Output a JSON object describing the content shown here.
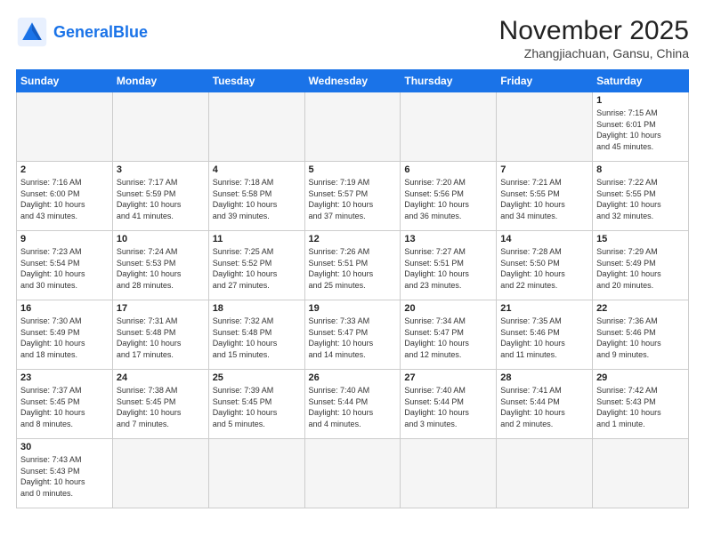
{
  "logo": {
    "text_general": "General",
    "text_blue": "Blue"
  },
  "title": "November 2025",
  "subtitle": "Zhangjiachuan, Gansu, China",
  "weekdays": [
    "Sunday",
    "Monday",
    "Tuesday",
    "Wednesday",
    "Thursday",
    "Friday",
    "Saturday"
  ],
  "weeks": [
    [
      {
        "day": "",
        "info": "",
        "empty": true
      },
      {
        "day": "",
        "info": "",
        "empty": true
      },
      {
        "day": "",
        "info": "",
        "empty": true
      },
      {
        "day": "",
        "info": "",
        "empty": true
      },
      {
        "day": "",
        "info": "",
        "empty": true
      },
      {
        "day": "",
        "info": "",
        "empty": true
      },
      {
        "day": "1",
        "info": "Sunrise: 7:15 AM\nSunset: 6:01 PM\nDaylight: 10 hours\nand 45 minutes."
      }
    ],
    [
      {
        "day": "2",
        "info": "Sunrise: 7:16 AM\nSunset: 6:00 PM\nDaylight: 10 hours\nand 43 minutes."
      },
      {
        "day": "3",
        "info": "Sunrise: 7:17 AM\nSunset: 5:59 PM\nDaylight: 10 hours\nand 41 minutes."
      },
      {
        "day": "4",
        "info": "Sunrise: 7:18 AM\nSunset: 5:58 PM\nDaylight: 10 hours\nand 39 minutes."
      },
      {
        "day": "5",
        "info": "Sunrise: 7:19 AM\nSunset: 5:57 PM\nDaylight: 10 hours\nand 37 minutes."
      },
      {
        "day": "6",
        "info": "Sunrise: 7:20 AM\nSunset: 5:56 PM\nDaylight: 10 hours\nand 36 minutes."
      },
      {
        "day": "7",
        "info": "Sunrise: 7:21 AM\nSunset: 5:55 PM\nDaylight: 10 hours\nand 34 minutes."
      },
      {
        "day": "8",
        "info": "Sunrise: 7:22 AM\nSunset: 5:55 PM\nDaylight: 10 hours\nand 32 minutes."
      }
    ],
    [
      {
        "day": "9",
        "info": "Sunrise: 7:23 AM\nSunset: 5:54 PM\nDaylight: 10 hours\nand 30 minutes."
      },
      {
        "day": "10",
        "info": "Sunrise: 7:24 AM\nSunset: 5:53 PM\nDaylight: 10 hours\nand 28 minutes."
      },
      {
        "day": "11",
        "info": "Sunrise: 7:25 AM\nSunset: 5:52 PM\nDaylight: 10 hours\nand 27 minutes."
      },
      {
        "day": "12",
        "info": "Sunrise: 7:26 AM\nSunset: 5:51 PM\nDaylight: 10 hours\nand 25 minutes."
      },
      {
        "day": "13",
        "info": "Sunrise: 7:27 AM\nSunset: 5:51 PM\nDaylight: 10 hours\nand 23 minutes."
      },
      {
        "day": "14",
        "info": "Sunrise: 7:28 AM\nSunset: 5:50 PM\nDaylight: 10 hours\nand 22 minutes."
      },
      {
        "day": "15",
        "info": "Sunrise: 7:29 AM\nSunset: 5:49 PM\nDaylight: 10 hours\nand 20 minutes."
      }
    ],
    [
      {
        "day": "16",
        "info": "Sunrise: 7:30 AM\nSunset: 5:49 PM\nDaylight: 10 hours\nand 18 minutes."
      },
      {
        "day": "17",
        "info": "Sunrise: 7:31 AM\nSunset: 5:48 PM\nDaylight: 10 hours\nand 17 minutes."
      },
      {
        "day": "18",
        "info": "Sunrise: 7:32 AM\nSunset: 5:48 PM\nDaylight: 10 hours\nand 15 minutes."
      },
      {
        "day": "19",
        "info": "Sunrise: 7:33 AM\nSunset: 5:47 PM\nDaylight: 10 hours\nand 14 minutes."
      },
      {
        "day": "20",
        "info": "Sunrise: 7:34 AM\nSunset: 5:47 PM\nDaylight: 10 hours\nand 12 minutes."
      },
      {
        "day": "21",
        "info": "Sunrise: 7:35 AM\nSunset: 5:46 PM\nDaylight: 10 hours\nand 11 minutes."
      },
      {
        "day": "22",
        "info": "Sunrise: 7:36 AM\nSunset: 5:46 PM\nDaylight: 10 hours\nand 9 minutes."
      }
    ],
    [
      {
        "day": "23",
        "info": "Sunrise: 7:37 AM\nSunset: 5:45 PM\nDaylight: 10 hours\nand 8 minutes."
      },
      {
        "day": "24",
        "info": "Sunrise: 7:38 AM\nSunset: 5:45 PM\nDaylight: 10 hours\nand 7 minutes."
      },
      {
        "day": "25",
        "info": "Sunrise: 7:39 AM\nSunset: 5:45 PM\nDaylight: 10 hours\nand 5 minutes."
      },
      {
        "day": "26",
        "info": "Sunrise: 7:40 AM\nSunset: 5:44 PM\nDaylight: 10 hours\nand 4 minutes."
      },
      {
        "day": "27",
        "info": "Sunrise: 7:40 AM\nSunset: 5:44 PM\nDaylight: 10 hours\nand 3 minutes."
      },
      {
        "day": "28",
        "info": "Sunrise: 7:41 AM\nSunset: 5:44 PM\nDaylight: 10 hours\nand 2 minutes."
      },
      {
        "day": "29",
        "info": "Sunrise: 7:42 AM\nSunset: 5:43 PM\nDaylight: 10 hours\nand 1 minute."
      }
    ],
    [
      {
        "day": "30",
        "info": "Sunrise: 7:43 AM\nSunset: 5:43 PM\nDaylight: 10 hours\nand 0 minutes."
      },
      {
        "day": "",
        "info": "",
        "empty": true
      },
      {
        "day": "",
        "info": "",
        "empty": true
      },
      {
        "day": "",
        "info": "",
        "empty": true
      },
      {
        "day": "",
        "info": "",
        "empty": true
      },
      {
        "day": "",
        "info": "",
        "empty": true
      },
      {
        "day": "",
        "info": "",
        "empty": true
      }
    ]
  ]
}
